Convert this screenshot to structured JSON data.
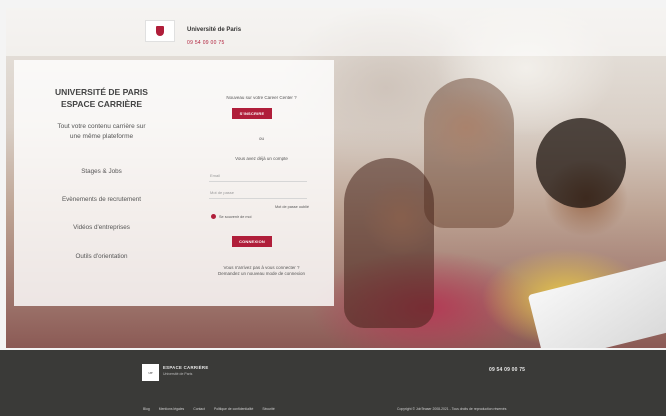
{
  "header": {
    "university_name": "Université de Paris",
    "phone": "09 54 09 00 75"
  },
  "left_panel": {
    "title_line1": "UNIVERSITÉ DE PARIS",
    "title_line2": "ESPACE CARRIÈRE",
    "tagline_line1": "Tout votre contenu carrière sur",
    "tagline_line2": "une même plateforme",
    "features": [
      "Stages & Jobs",
      "Evènements de recrutement",
      "Vidéos d'entreprises",
      "Outils d'orientation"
    ]
  },
  "login": {
    "new_prompt": "Nouveau sur votre Career Center ?",
    "register_button": "S'INSCRIRE",
    "or_text": "ou",
    "already_text": "Vous avez déjà un compte",
    "email_placeholder": "Email",
    "password_placeholder": "Mot de passe",
    "forgot_password": "Mot de passe oublié",
    "remember_me": "Se souvenir de moi",
    "login_button": "CONNEXION",
    "help_line1": "Vous n'arrivez pas à vous connecter ?",
    "help_line2": "Demandez un nouveau mode de connexion"
  },
  "footer": {
    "logo_text": "UP",
    "brand": "ESPACE CARRIÈRE",
    "brand_sub": "Université de Paris",
    "phone": "09 54 09 00 75",
    "links": [
      "Blog",
      "Mentions légales",
      "Contact",
      "Politique de confidentialité",
      "Sécurité"
    ],
    "copyright": "Copyright © JobTeaser 2008-2021 - Tous droits de reproduction réservés"
  },
  "colors": {
    "accent": "#b01e3a",
    "footer_bg": "#3a3a38"
  }
}
